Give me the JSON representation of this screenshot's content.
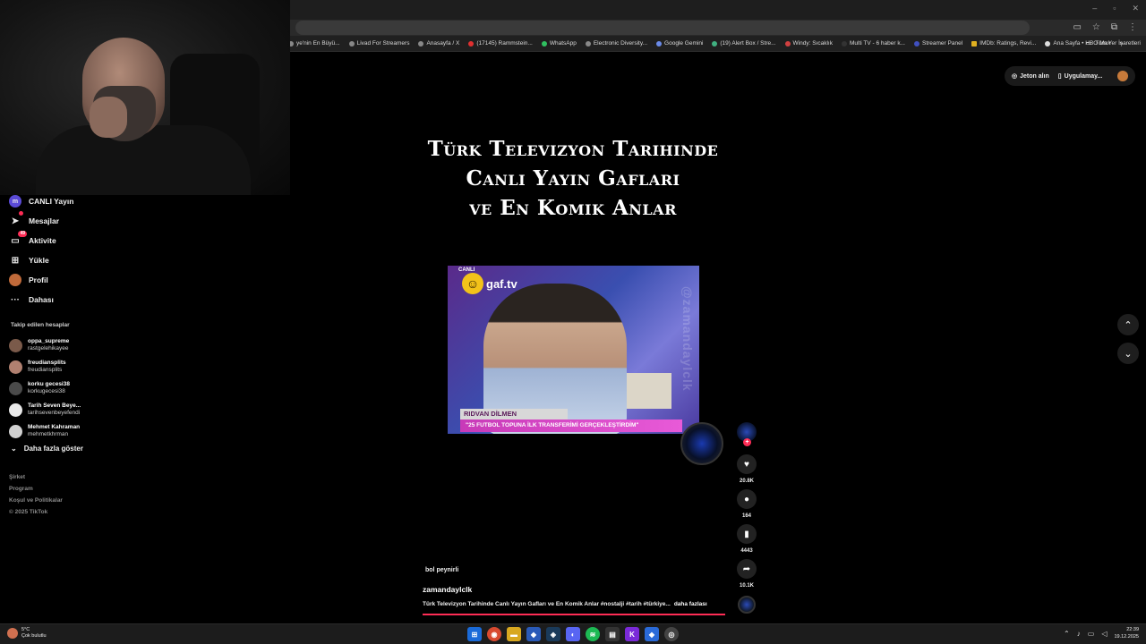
{
  "window": {
    "minimize": "–",
    "maximize": "▫",
    "close": "✕"
  },
  "bookmarks": [
    "ye'nin En Büyü...",
    "Livad For Streamers",
    "Anasayfa / X",
    "(17145) Rammstein...",
    "WhatsApp",
    "Electronic Diversity...",
    "Google Gemini",
    "(19) Alert Box / Stre...",
    "Windy: Sıcaklık",
    "Multi TV - 6 haber k...",
    "Streamer Panel",
    "IMDb: Ratings, Revi...",
    "Ana Sayfa • HBO Max"
  ],
  "bookmarks_more": "»",
  "bookmarks_all": "Tüm Yer İşaretleri",
  "nav": {
    "items": [
      {
        "label": "CANLI Yayın",
        "icon": "live-icon",
        "glyph": "m"
      },
      {
        "label": "Mesajlar",
        "icon": "send-icon",
        "glyph": "➤",
        "badge": ""
      },
      {
        "label": "Aktivite",
        "icon": "inbox-icon",
        "glyph": "▭",
        "badge": "49"
      },
      {
        "label": "Yükle",
        "icon": "upload-icon",
        "glyph": "⊞"
      },
      {
        "label": "Profil",
        "icon": "profile-icon",
        "glyph": ""
      },
      {
        "label": "Dahası",
        "icon": "more-icon",
        "glyph": "···"
      }
    ]
  },
  "following": {
    "title": "Takip edilen hesaplar",
    "accounts": [
      {
        "name": "oppa_supreme",
        "handle": "rastgelehikayee"
      },
      {
        "name": "freudiansplits",
        "handle": "freudiansplits"
      },
      {
        "name": "korku gecesi38",
        "handle": "korkugecesi38"
      },
      {
        "name": "Tarih Seven Beye...",
        "handle": "tarihsevenbeyefendi"
      },
      {
        "name": "Mehmet Kahraman",
        "handle": "mehmetkhrman"
      }
    ],
    "show_more": "Daha fazla göster"
  },
  "footer": [
    "Şirket",
    "Program",
    "Koşul ve Politikalar",
    "© 2025 TikTok"
  ],
  "top_right": {
    "coins": "Jeton alın",
    "app": "Uygulamay..."
  },
  "video": {
    "title_lines": [
      "Türk Televizyon Tarihinde",
      "Canlı Yayın Gafları",
      "ve En Komik Anlar"
    ],
    "logo_text": "gaf.tv",
    "live_text": "CANLI",
    "lower_name": "RIDVAN DİLMEN",
    "lower_sub": "\"25 FUTBOL TOPUNA İLK TRANSFERİMİ GERÇEKLEŞTİRDİM\"",
    "watermark": "@zamandaylclk"
  },
  "actions": {
    "likes": "20.8K",
    "comments": "164",
    "saves": "4443",
    "shares": "10.1K"
  },
  "caption": {
    "subtitle": "bol peynirli",
    "username": "zamandaylclk",
    "description": "Türk Televizyon Tarihinde Canlı Yayın Gafları ve En Komik Anlar #nostalji #tarih #türkiye...",
    "more": "daha fazlası",
    "progress": 1.0
  },
  "weather": {
    "temp": "5°C",
    "desc": "Çok bulutlu"
  },
  "clock": {
    "time": "22:39",
    "date": "19.12.2025"
  },
  "colors": {
    "accent": "#fe2c55",
    "background": "#000000"
  }
}
